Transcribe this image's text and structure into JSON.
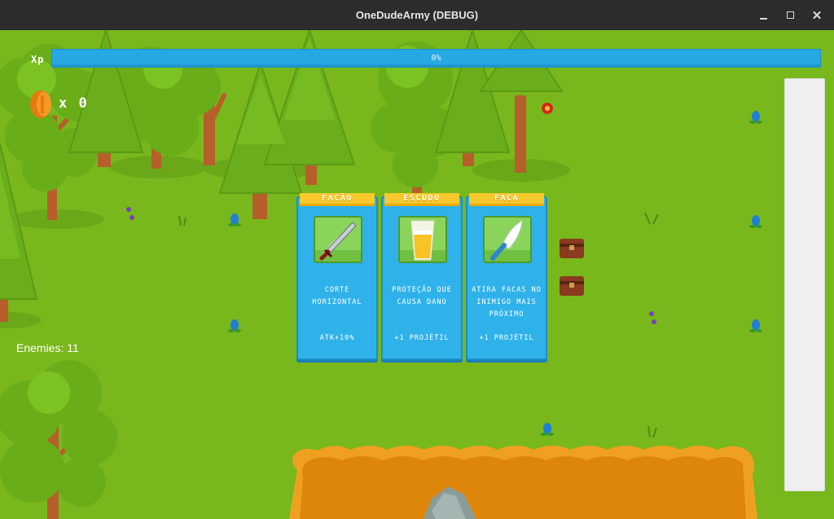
{
  "window": {
    "title": "OneDudeArmy (DEBUG)"
  },
  "hud": {
    "xp_label": "Xp",
    "xp_text": "0%",
    "xp_progress": 0,
    "coin_icon": "coin-icon",
    "coin_count": "x 0",
    "enemies": "Enemies: 11"
  },
  "upgrades": [
    {
      "title": "FACÃO",
      "icon": "machete-icon",
      "description": "CORTE HORIZONTAL",
      "bonus": "ATK+10%"
    },
    {
      "title": "ESCUDO",
      "icon": "shield-cup-icon",
      "description": "PROTEÇÃO QUE CAUSA DANO",
      "bonus": "+1 PROJÉTIL"
    },
    {
      "title": "FACA",
      "icon": "knife-icon",
      "description": "ATIRA FACAS NO INIMIGO MAIS PRÓXIMO",
      "bonus": "+1 PROJÉTIL"
    }
  ],
  "colors": {
    "grass": "#78b81c",
    "xp_bar": "#26a9e3",
    "card": "#2fb2ea",
    "card_title": "#f8c92c",
    "lava": "#e08c0a"
  }
}
